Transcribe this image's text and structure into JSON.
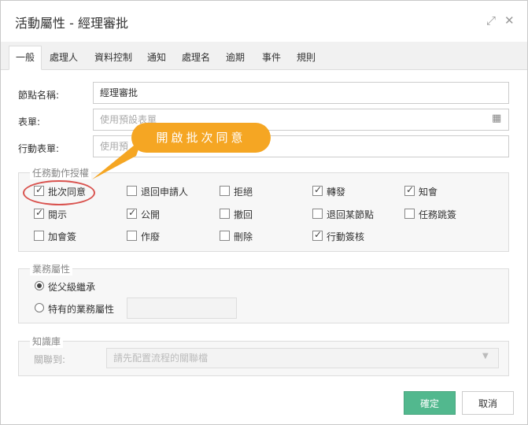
{
  "window": {
    "title": "活動屬性 - 經理審批"
  },
  "tabs": [
    "一般",
    "處理人",
    "資料控制",
    "通知",
    "處理名",
    "逾期",
    "事件",
    "規則"
  ],
  "form": {
    "node_name_label": "節點名稱:",
    "node_name_value": "經理審批",
    "form_label": "表單:",
    "form_placeholder": "使用預設表單",
    "mobile_form_label": "行動表單:",
    "mobile_form_placeholder": "使用預"
  },
  "callout": "開啟批次同意",
  "permissions": {
    "legend": "任務動作授權",
    "items": [
      {
        "label": "批次同意",
        "checked": true
      },
      {
        "label": "退回申請人",
        "checked": false
      },
      {
        "label": "拒絕",
        "checked": false
      },
      {
        "label": "轉發",
        "checked": true
      },
      {
        "label": "知會",
        "checked": true
      },
      {
        "label": "閱示",
        "checked": true
      },
      {
        "label": "公開",
        "checked": true
      },
      {
        "label": "撤回",
        "checked": false
      },
      {
        "label": "退回某節點",
        "checked": false
      },
      {
        "label": "任務跳簽",
        "checked": false
      },
      {
        "label": "加會簽",
        "checked": false
      },
      {
        "label": "作廢",
        "checked": false
      },
      {
        "label": "刪除",
        "checked": false
      },
      {
        "label": "行動簽核",
        "checked": true
      }
    ]
  },
  "business": {
    "legend": "業務屬性",
    "options": [
      {
        "label": "從父級繼承",
        "selected": true
      },
      {
        "label": "特有的業務屬性",
        "selected": false
      }
    ]
  },
  "knowledge": {
    "legend": "知識庫",
    "related_label": "關聯到:",
    "related_placeholder": "請先配置流程的關聯檔"
  },
  "buttons": {
    "ok": "確定",
    "cancel": "取消"
  }
}
